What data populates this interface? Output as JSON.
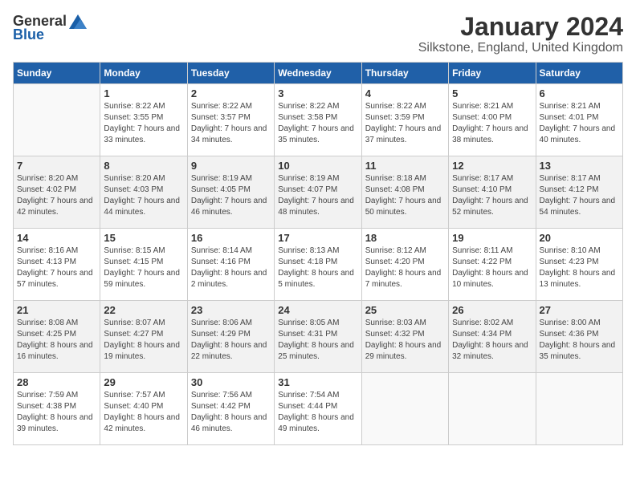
{
  "header": {
    "logo_general": "General",
    "logo_blue": "Blue",
    "month_title": "January 2024",
    "location": "Silkstone, England, United Kingdom"
  },
  "days_of_week": [
    "Sunday",
    "Monday",
    "Tuesday",
    "Wednesday",
    "Thursday",
    "Friday",
    "Saturday"
  ],
  "weeks": [
    [
      {
        "day": "",
        "sunrise": "",
        "sunset": "",
        "daylight": "",
        "empty": true
      },
      {
        "day": "1",
        "sunrise": "Sunrise: 8:22 AM",
        "sunset": "Sunset: 3:55 PM",
        "daylight": "Daylight: 7 hours and 33 minutes."
      },
      {
        "day": "2",
        "sunrise": "Sunrise: 8:22 AM",
        "sunset": "Sunset: 3:57 PM",
        "daylight": "Daylight: 7 hours and 34 minutes."
      },
      {
        "day": "3",
        "sunrise": "Sunrise: 8:22 AM",
        "sunset": "Sunset: 3:58 PM",
        "daylight": "Daylight: 7 hours and 35 minutes."
      },
      {
        "day": "4",
        "sunrise": "Sunrise: 8:22 AM",
        "sunset": "Sunset: 3:59 PM",
        "daylight": "Daylight: 7 hours and 37 minutes."
      },
      {
        "day": "5",
        "sunrise": "Sunrise: 8:21 AM",
        "sunset": "Sunset: 4:00 PM",
        "daylight": "Daylight: 7 hours and 38 minutes."
      },
      {
        "day": "6",
        "sunrise": "Sunrise: 8:21 AM",
        "sunset": "Sunset: 4:01 PM",
        "daylight": "Daylight: 7 hours and 40 minutes."
      }
    ],
    [
      {
        "day": "7",
        "sunrise": "Sunrise: 8:20 AM",
        "sunset": "Sunset: 4:02 PM",
        "daylight": "Daylight: 7 hours and 42 minutes."
      },
      {
        "day": "8",
        "sunrise": "Sunrise: 8:20 AM",
        "sunset": "Sunset: 4:03 PM",
        "daylight": "Daylight: 7 hours and 44 minutes."
      },
      {
        "day": "9",
        "sunrise": "Sunrise: 8:19 AM",
        "sunset": "Sunset: 4:05 PM",
        "daylight": "Daylight: 7 hours and 46 minutes."
      },
      {
        "day": "10",
        "sunrise": "Sunrise: 8:19 AM",
        "sunset": "Sunset: 4:07 PM",
        "daylight": "Daylight: 7 hours and 48 minutes."
      },
      {
        "day": "11",
        "sunrise": "Sunrise: 8:18 AM",
        "sunset": "Sunset: 4:08 PM",
        "daylight": "Daylight: 7 hours and 50 minutes."
      },
      {
        "day": "12",
        "sunrise": "Sunrise: 8:17 AM",
        "sunset": "Sunset: 4:10 PM",
        "daylight": "Daylight: 7 hours and 52 minutes."
      },
      {
        "day": "13",
        "sunrise": "Sunrise: 8:17 AM",
        "sunset": "Sunset: 4:12 PM",
        "daylight": "Daylight: 7 hours and 54 minutes."
      }
    ],
    [
      {
        "day": "14",
        "sunrise": "Sunrise: 8:16 AM",
        "sunset": "Sunset: 4:13 PM",
        "daylight": "Daylight: 7 hours and 57 minutes."
      },
      {
        "day": "15",
        "sunrise": "Sunrise: 8:15 AM",
        "sunset": "Sunset: 4:15 PM",
        "daylight": "Daylight: 7 hours and 59 minutes."
      },
      {
        "day": "16",
        "sunrise": "Sunrise: 8:14 AM",
        "sunset": "Sunset: 4:16 PM",
        "daylight": "Daylight: 8 hours and 2 minutes."
      },
      {
        "day": "17",
        "sunrise": "Sunrise: 8:13 AM",
        "sunset": "Sunset: 4:18 PM",
        "daylight": "Daylight: 8 hours and 5 minutes."
      },
      {
        "day": "18",
        "sunrise": "Sunrise: 8:12 AM",
        "sunset": "Sunset: 4:20 PM",
        "daylight": "Daylight: 8 hours and 7 minutes."
      },
      {
        "day": "19",
        "sunrise": "Sunrise: 8:11 AM",
        "sunset": "Sunset: 4:22 PM",
        "daylight": "Daylight: 8 hours and 10 minutes."
      },
      {
        "day": "20",
        "sunrise": "Sunrise: 8:10 AM",
        "sunset": "Sunset: 4:23 PM",
        "daylight": "Daylight: 8 hours and 13 minutes."
      }
    ],
    [
      {
        "day": "21",
        "sunrise": "Sunrise: 8:08 AM",
        "sunset": "Sunset: 4:25 PM",
        "daylight": "Daylight: 8 hours and 16 minutes."
      },
      {
        "day": "22",
        "sunrise": "Sunrise: 8:07 AM",
        "sunset": "Sunset: 4:27 PM",
        "daylight": "Daylight: 8 hours and 19 minutes."
      },
      {
        "day": "23",
        "sunrise": "Sunrise: 8:06 AM",
        "sunset": "Sunset: 4:29 PM",
        "daylight": "Daylight: 8 hours and 22 minutes."
      },
      {
        "day": "24",
        "sunrise": "Sunrise: 8:05 AM",
        "sunset": "Sunset: 4:31 PM",
        "daylight": "Daylight: 8 hours and 25 minutes."
      },
      {
        "day": "25",
        "sunrise": "Sunrise: 8:03 AM",
        "sunset": "Sunset: 4:32 PM",
        "daylight": "Daylight: 8 hours and 29 minutes."
      },
      {
        "day": "26",
        "sunrise": "Sunrise: 8:02 AM",
        "sunset": "Sunset: 4:34 PM",
        "daylight": "Daylight: 8 hours and 32 minutes."
      },
      {
        "day": "27",
        "sunrise": "Sunrise: 8:00 AM",
        "sunset": "Sunset: 4:36 PM",
        "daylight": "Daylight: 8 hours and 35 minutes."
      }
    ],
    [
      {
        "day": "28",
        "sunrise": "Sunrise: 7:59 AM",
        "sunset": "Sunset: 4:38 PM",
        "daylight": "Daylight: 8 hours and 39 minutes."
      },
      {
        "day": "29",
        "sunrise": "Sunrise: 7:57 AM",
        "sunset": "Sunset: 4:40 PM",
        "daylight": "Daylight: 8 hours and 42 minutes."
      },
      {
        "day": "30",
        "sunrise": "Sunrise: 7:56 AM",
        "sunset": "Sunset: 4:42 PM",
        "daylight": "Daylight: 8 hours and 46 minutes."
      },
      {
        "day": "31",
        "sunrise": "Sunrise: 7:54 AM",
        "sunset": "Sunset: 4:44 PM",
        "daylight": "Daylight: 8 hours and 49 minutes."
      },
      {
        "day": "",
        "sunrise": "",
        "sunset": "",
        "daylight": "",
        "empty": true
      },
      {
        "day": "",
        "sunrise": "",
        "sunset": "",
        "daylight": "",
        "empty": true
      },
      {
        "day": "",
        "sunrise": "",
        "sunset": "",
        "daylight": "",
        "empty": true
      }
    ]
  ]
}
